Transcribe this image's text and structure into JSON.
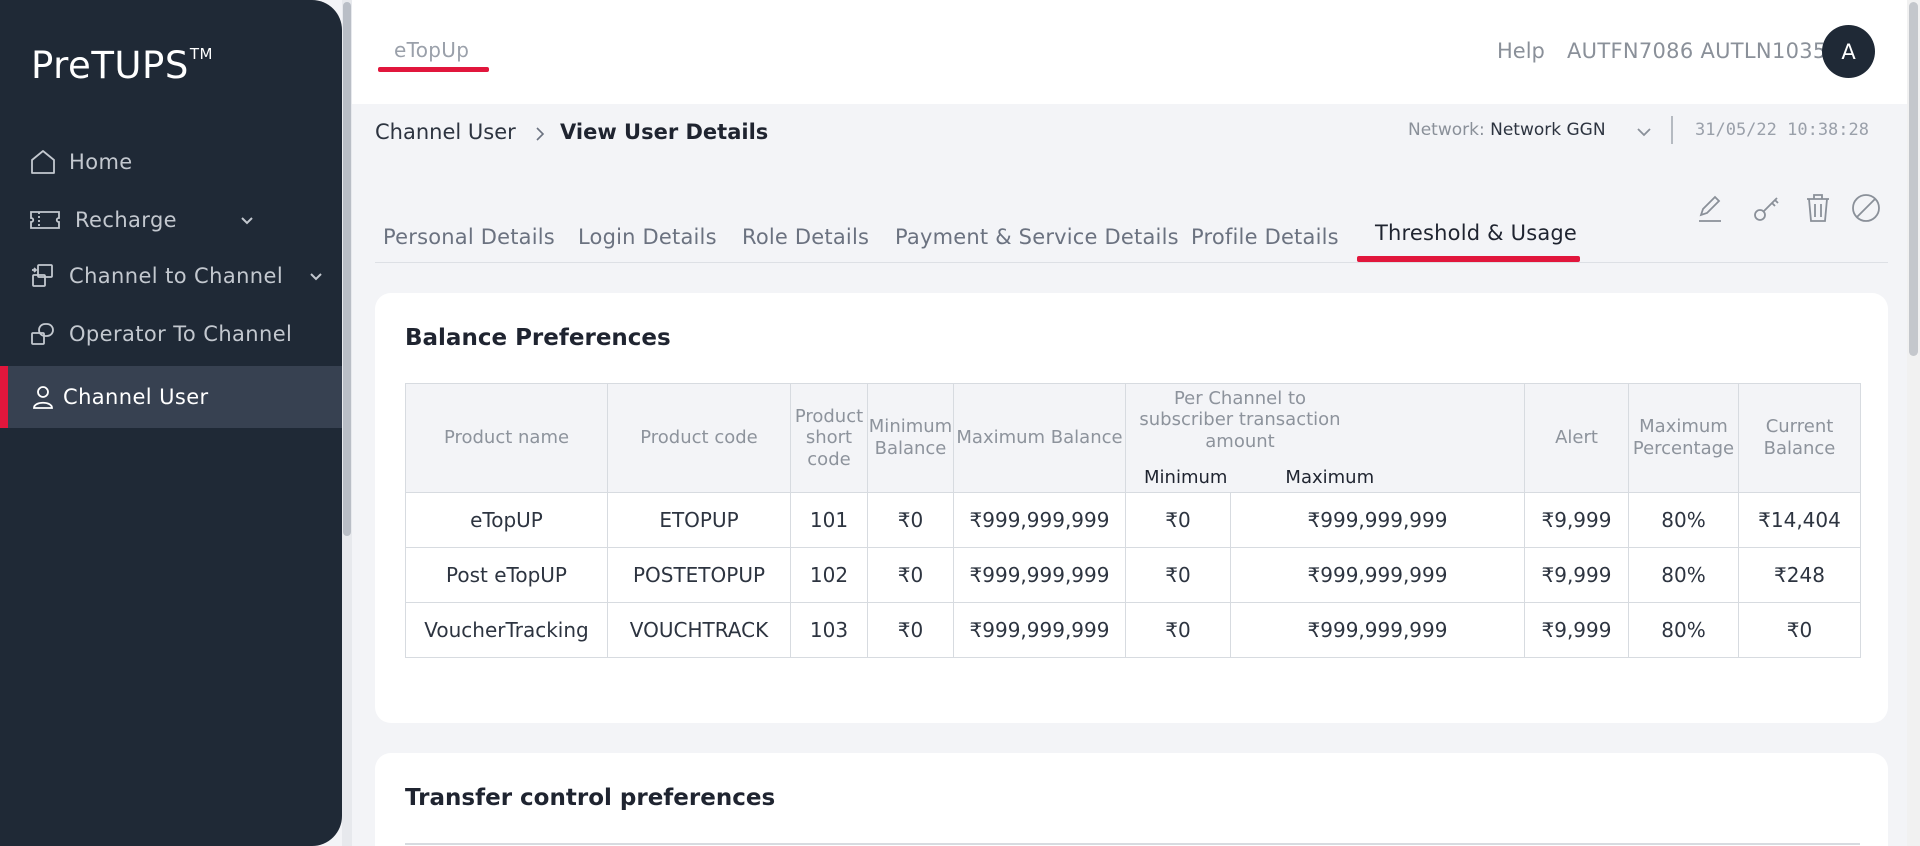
{
  "app": {
    "logo_text": "PreTUPS",
    "logo_mark": "TM"
  },
  "sidebar": {
    "items": [
      {
        "label": "Home",
        "icon": "home-icon",
        "has_chevron": false,
        "active": false
      },
      {
        "label": "Recharge",
        "icon": "ticket-icon",
        "has_chevron": true,
        "active": false
      },
      {
        "label": "Channel to Channel",
        "icon": "transfer-icon",
        "has_chevron": true,
        "active": false
      },
      {
        "label": "Operator To Channel",
        "icon": "operator-icon",
        "has_chevron": false,
        "active": false
      },
      {
        "label": "Channel User",
        "icon": "user-icon",
        "has_chevron": false,
        "active": true
      }
    ]
  },
  "header": {
    "module_tab": "eTopUp",
    "help_label": "Help",
    "user_name": "AUTFN7086 AUTLN1035",
    "avatar_initial": "A"
  },
  "breadcrumb": {
    "parent": "Channel User",
    "current": "View User Details"
  },
  "context": {
    "network_label": "Network:",
    "network_value": "Network GGN",
    "datetime": "31/05/22 10:38:28"
  },
  "tabs": [
    {
      "label": "Personal Details",
      "active": false
    },
    {
      "label": "Login Details",
      "active": false
    },
    {
      "label": "Role Details",
      "active": false
    },
    {
      "label": "Payment & Service Details",
      "active": false
    },
    {
      "label": "Profile Details",
      "active": false
    },
    {
      "label": "Threshold & Usage",
      "active": true
    }
  ],
  "actions": [
    "edit-icon",
    "key-icon",
    "delete-icon",
    "block-icon"
  ],
  "balance_preferences": {
    "title": "Balance Preferences",
    "headers": {
      "product_name": "Product name",
      "product_code": "Product code",
      "short_code": "Product short code",
      "min_balance": "Minimum Balance",
      "max_balance": "Maximum Balance",
      "per_channel": "Per Channel to subscriber transaction amount",
      "per_min": "Minimum",
      "per_max": "Maximum",
      "alert": "Alert",
      "max_pct": "Maximum Percentage",
      "current_balance": "Current Balance"
    },
    "rows": [
      {
        "name": "eTopUP",
        "code": "ETOPUP",
        "short": "101",
        "min": "₹0",
        "max": "₹999,999,999",
        "pmin": "₹0",
        "pmax": "₹999,999,999",
        "alert": "₹9,999",
        "pct": "80%",
        "current": "₹14,404"
      },
      {
        "name": "Post eTopUP",
        "code": "POSTETOPUP",
        "short": "102",
        "min": "₹0",
        "max": "₹999,999,999",
        "pmin": "₹0",
        "pmax": "₹999,999,999",
        "alert": "₹9,999",
        "pct": "80%",
        "current": "₹248"
      },
      {
        "name": "VoucherTracking",
        "code": "VOUCHTRACK",
        "short": "103",
        "min": "₹0",
        "max": "₹999,999,999",
        "pmin": "₹0",
        "pmax": "₹999,999,999",
        "alert": "₹9,999",
        "pct": "80%",
        "current": "₹0"
      }
    ]
  },
  "transfer_control": {
    "title": "Transfer control preferences"
  },
  "colors": {
    "accent": "#e1163c",
    "sidebar_bg": "#1f2936",
    "sidebar_active": "#374151"
  }
}
